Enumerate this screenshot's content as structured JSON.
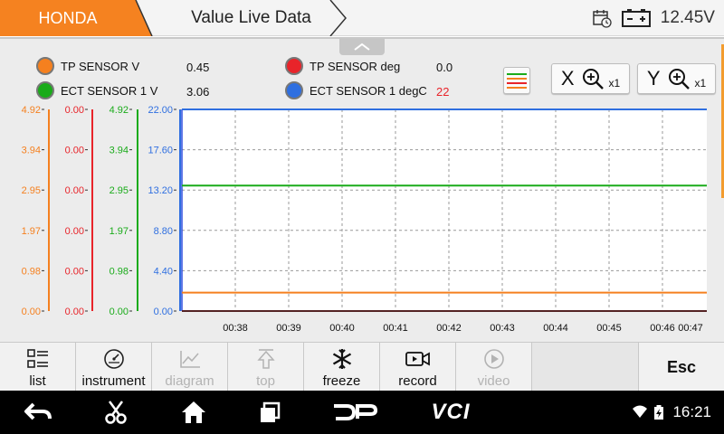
{
  "header": {
    "brand": "HONDA",
    "title": "Value Live Data",
    "voltage": "12.45V",
    "colors": {
      "brand": "#f58220"
    }
  },
  "legend": [
    {
      "name": "TP SENSOR  V",
      "value": "0.45",
      "color": "#f5801f"
    },
    {
      "name": "ECT SENSOR 1  V",
      "value": "3.06",
      "color": "#1aab1a"
    },
    {
      "name": "TP SENSOR  deg",
      "value": "0.0",
      "color": "#e8242a"
    },
    {
      "name": "ECT SENSOR 1  degC",
      "value": "22",
      "color": "#2f6fe0",
      "value_color": "#e8242a"
    }
  ],
  "zoom": {
    "x_label": "X",
    "x_level": "x1",
    "y_label": "Y",
    "y_level": "x1"
  },
  "chart_data": {
    "type": "line",
    "x": [
      "00:38",
      "00:39",
      "00:40",
      "00:41",
      "00:42",
      "00:43",
      "00:44",
      "00:45",
      "00:46",
      "00:47"
    ],
    "axes": [
      {
        "color": "#f5801f",
        "ticks": [
          "4.92",
          "3.94",
          "2.95",
          "1.97",
          "0.98",
          "0.00"
        ],
        "ylim": [
          0,
          4.92
        ]
      },
      {
        "color": "#e8242a",
        "ticks": [
          "0.00",
          "0.00",
          "0.00",
          "0.00",
          "0.00",
          "0.00"
        ],
        "ylim": [
          0,
          0
        ]
      },
      {
        "color": "#1aab1a",
        "ticks": [
          "4.92",
          "3.94",
          "2.95",
          "1.97",
          "0.98",
          "0.00"
        ],
        "ylim": [
          0,
          4.92
        ]
      },
      {
        "color": "#2f6fe0",
        "ticks": [
          "22.00",
          "17.60",
          "13.20",
          "8.80",
          "4.40",
          "0.00"
        ],
        "ylim": [
          0,
          22
        ]
      }
    ],
    "series": [
      {
        "name": "TP SENSOR  V",
        "axis": 0,
        "values": [
          0.45,
          0.45,
          0.45,
          0.45,
          0.45,
          0.45,
          0.45,
          0.45,
          0.45,
          0.45
        ],
        "color": "#f5801f"
      },
      {
        "name": "ECT SENSOR 1  V",
        "axis": 2,
        "values": [
          3.06,
          3.06,
          3.06,
          3.06,
          3.06,
          3.06,
          3.06,
          3.06,
          3.06,
          3.06
        ],
        "color": "#1aab1a"
      },
      {
        "name": "TP SENSOR  deg",
        "axis": 1,
        "values": [
          0,
          0,
          0,
          0,
          0,
          0,
          0,
          0,
          0,
          0
        ],
        "color": "#e8242a"
      },
      {
        "name": "ECT SENSOR 1  degC",
        "axis": 3,
        "values": [
          22,
          22,
          22,
          22,
          22,
          22,
          22,
          22,
          22,
          22
        ],
        "color": "#2f6fe0"
      }
    ],
    "grid": true
  },
  "toolbar": [
    {
      "key": "list",
      "label": "list",
      "icon": "list-icon",
      "enabled": true
    },
    {
      "key": "instrument",
      "label": "instrument",
      "icon": "gauge-icon",
      "enabled": true
    },
    {
      "key": "diagram",
      "label": "diagram",
      "icon": "diagram-icon",
      "enabled": false
    },
    {
      "key": "top",
      "label": "top",
      "icon": "arrow-up-icon",
      "enabled": false
    },
    {
      "key": "freeze",
      "label": "freeze",
      "icon": "snowflake-icon",
      "enabled": true
    },
    {
      "key": "record",
      "label": "record",
      "icon": "camera-icon",
      "enabled": true
    },
    {
      "key": "video",
      "label": "video",
      "icon": "play-icon",
      "enabled": false
    }
  ],
  "esc_label": "Esc",
  "navbar": {
    "time": "16:21",
    "logo1": "DP",
    "logo2": "VCI"
  }
}
